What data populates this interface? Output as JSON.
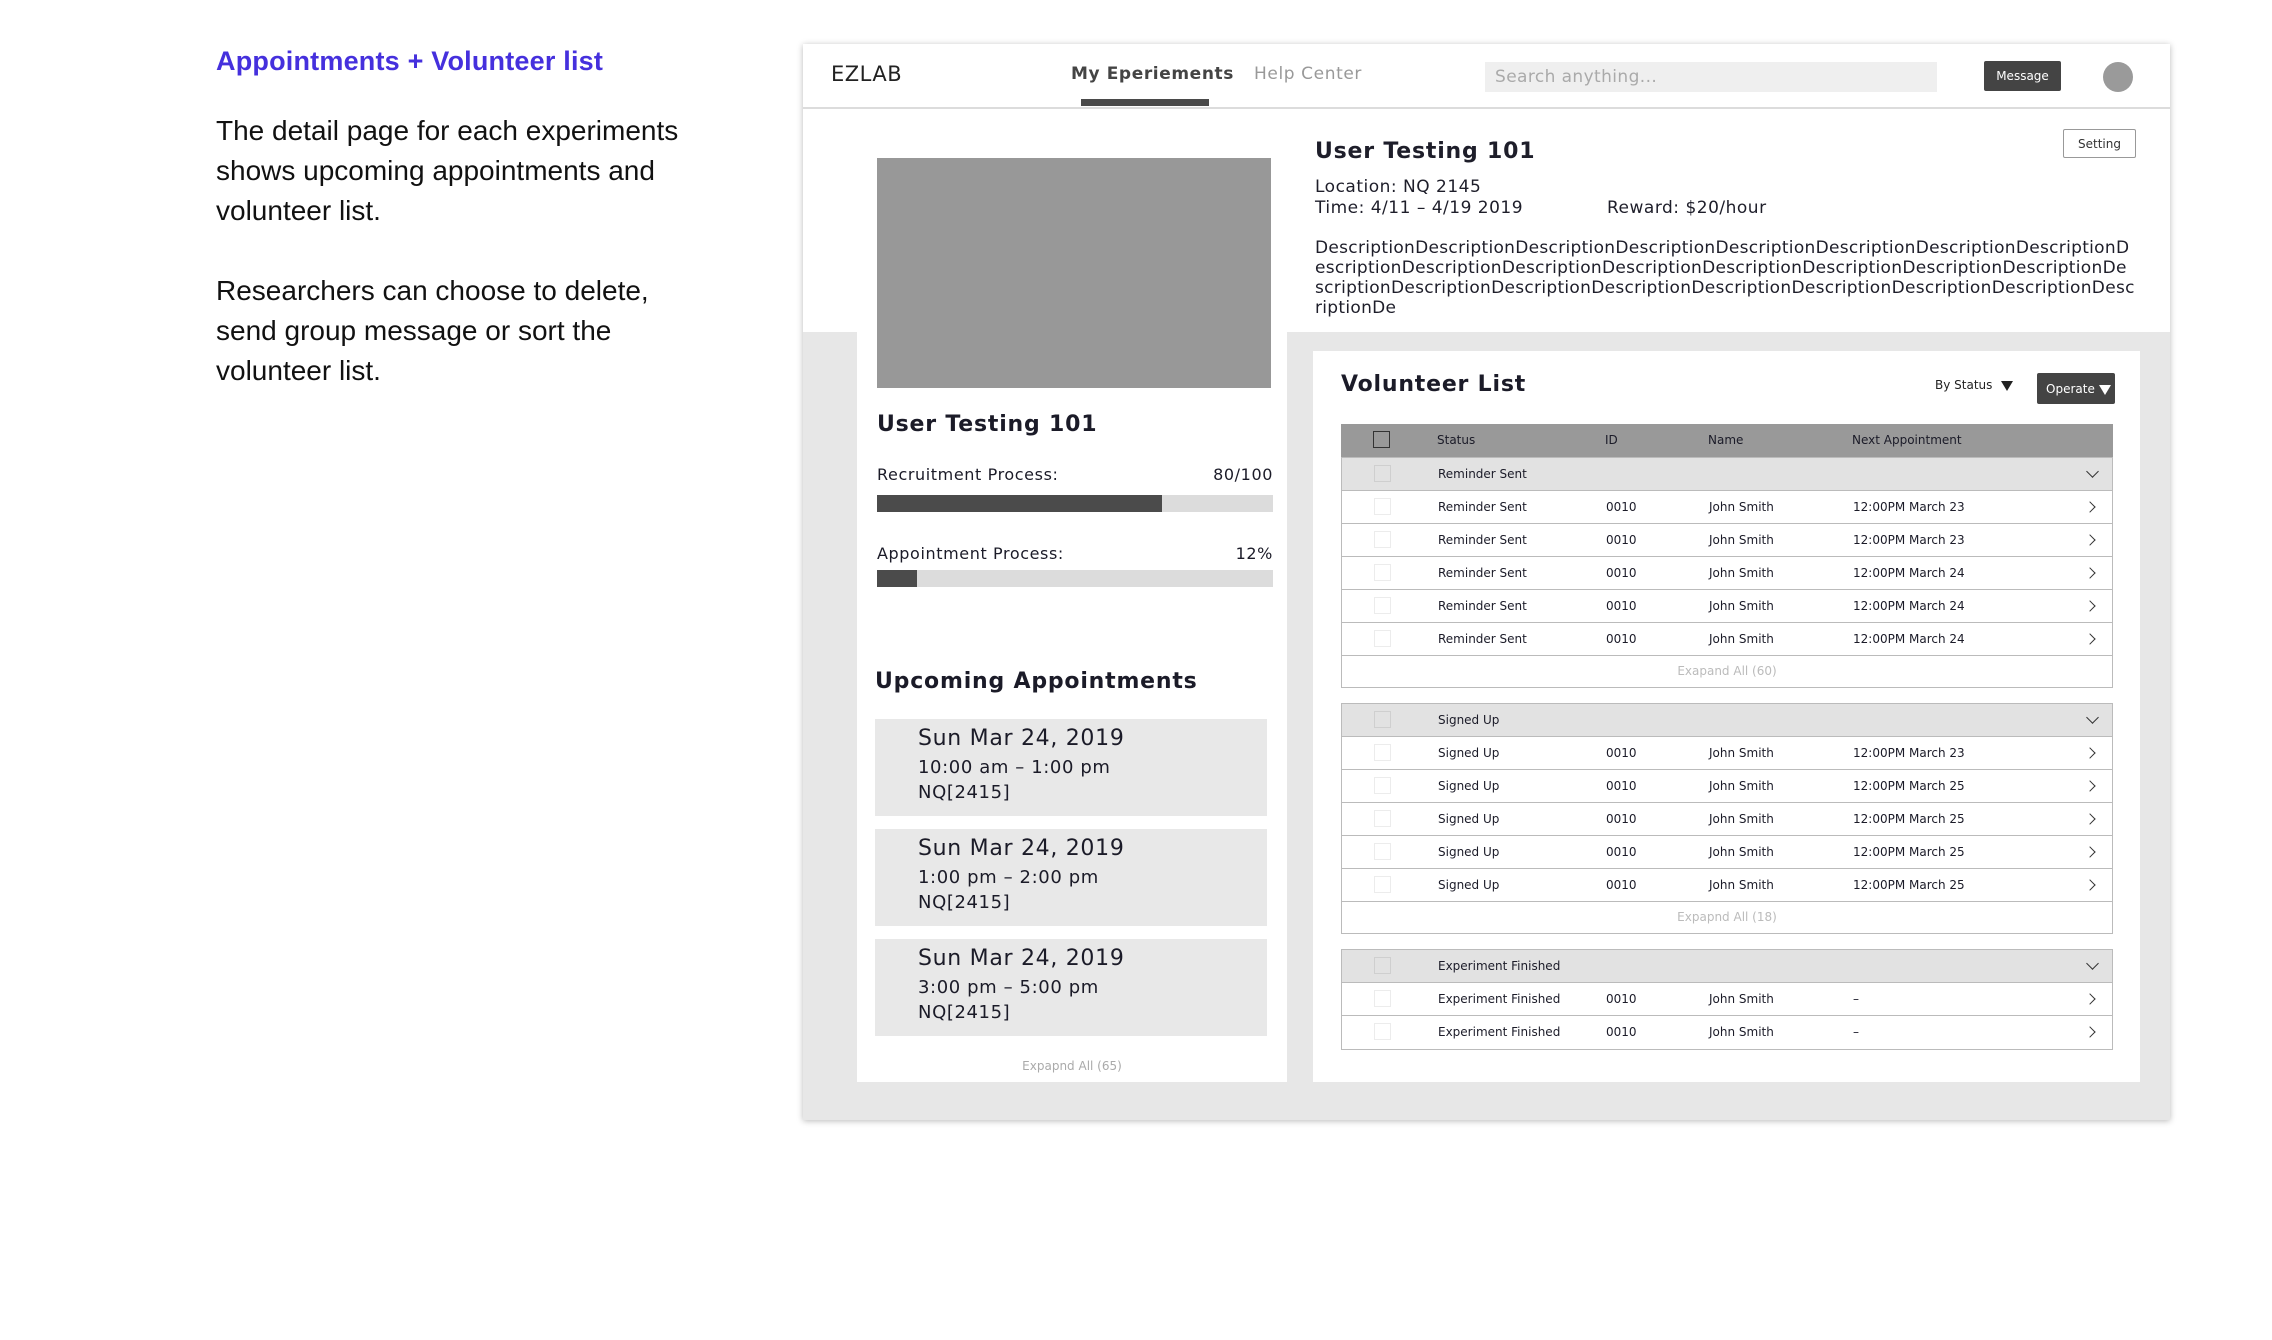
{
  "notes": {
    "title": "Appointments + Volunteer list",
    "para1": "The detail page for each experiments shows upcoming appointments and volunteer list.",
    "para2": "Researchers can choose to delete, send group message or sort the volunteer list."
  },
  "navbar": {
    "brand": "EZLAB",
    "tabs": [
      {
        "label": "My Eperiements",
        "active": true
      },
      {
        "label": "Help Center",
        "active": false
      }
    ],
    "search_placeholder": "Search anything...",
    "message_label": "Message"
  },
  "experiment": {
    "setting_label": "Setting",
    "title": "User Testing 101",
    "location": "Location: NQ 2145",
    "time": "Time: 4/11 – 4/19 2019",
    "reward": "Reward: $20/hour",
    "description": "DescriptionDescriptionDescriptionDescriptionDescriptionDescriptionDescriptionDescriptionDescriptionDescriptionDescriptionDescriptionDescriptionDescriptionDescriptionDescriptionDescriptionDescriptionDescriptionDescriptionDescriptionDescriptionDescriptionDescriptionDescriptionDe",
    "card_title": "User Testing 101",
    "recruitment": {
      "label": "Recruitment Process:",
      "value": "80/100",
      "fraction": 0.72
    },
    "appointment": {
      "label": "Appointment Process:",
      "value": "12%",
      "fraction": 0.1
    }
  },
  "appointments": {
    "title": "Upcoming Appointments",
    "items": [
      {
        "date": "Sun Mar 24, 2019",
        "time": "10:00 am – 1:00 pm",
        "location": "NQ[2415]"
      },
      {
        "date": "Sun Mar 24, 2019",
        "time": "1:00 pm – 2:00 pm",
        "location": "NQ[2415]"
      },
      {
        "date": "Sun Mar 24, 2019",
        "time": "3:00 pm – 5:00 pm",
        "location": "NQ[2415]"
      }
    ],
    "expand_label": "Expapnd All (65)"
  },
  "volunteers": {
    "title": "Volunteer List",
    "sort_label": "By Status",
    "operate_label": "Operate",
    "columns": {
      "status": "Status",
      "id": "ID",
      "name": "Name",
      "next": "Next Appointment"
    },
    "groups": [
      {
        "label": "Reminder Sent",
        "rows": [
          {
            "status": "Reminder Sent",
            "id": "0010",
            "name": "John Smith",
            "next": "12:00PM March 23"
          },
          {
            "status": "Reminder Sent",
            "id": "0010",
            "name": "John Smith",
            "next": "12:00PM March 23"
          },
          {
            "status": "Reminder Sent",
            "id": "0010",
            "name": "John Smith",
            "next": "12:00PM March 24"
          },
          {
            "status": "Reminder Sent",
            "id": "0010",
            "name": "John Smith",
            "next": "12:00PM March 24"
          },
          {
            "status": "Reminder Sent",
            "id": "0010",
            "name": "John Smith",
            "next": "12:00PM March 24"
          }
        ],
        "expand_label": "Exapand All (60)"
      },
      {
        "label": "Signed Up",
        "rows": [
          {
            "status": "Signed Up",
            "id": "0010",
            "name": "John Smith",
            "next": "12:00PM March 23"
          },
          {
            "status": "Signed Up",
            "id": "0010",
            "name": "John Smith",
            "next": "12:00PM March 25"
          },
          {
            "status": "Signed Up",
            "id": "0010",
            "name": "John Smith",
            "next": "12:00PM March 25"
          },
          {
            "status": "Signed Up",
            "id": "0010",
            "name": "John Smith",
            "next": "12:00PM March 25"
          },
          {
            "status": "Signed Up",
            "id": "0010",
            "name": "John Smith",
            "next": "12:00PM March 25"
          }
        ],
        "expand_label": "Expapnd All (18)"
      },
      {
        "label": "Experiment Finished",
        "rows": [
          {
            "status": "Experiment Finished",
            "id": "0010",
            "name": "John Smith",
            "next": "–"
          },
          {
            "status": "Experiment Finished",
            "id": "0010",
            "name": "John Smith",
            "next": "–"
          }
        ],
        "expand_label": ""
      }
    ]
  },
  "colors": {
    "accent": "#4530dd",
    "dark_button": "#444444",
    "page_gray": "#e7e7e7",
    "bar_fill": "#4b4b4b"
  }
}
